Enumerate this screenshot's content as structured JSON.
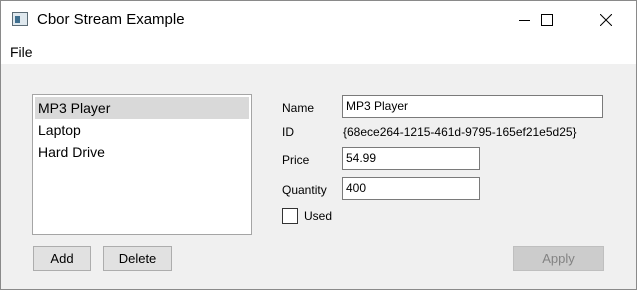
{
  "window": {
    "title": "Cbor Stream Example",
    "icon": "app-window-icon",
    "controls": [
      "minimize-icon",
      "maximize-icon",
      "close-icon"
    ]
  },
  "menu": {
    "file_label": "File"
  },
  "list": {
    "items": [
      {
        "label": "MP3 Player",
        "selected": true
      },
      {
        "label": "Laptop",
        "selected": false
      },
      {
        "label": "Hard Drive",
        "selected": false
      }
    ]
  },
  "buttons": {
    "add_label": "Add",
    "delete_label": "Delete",
    "apply_label": "Apply",
    "apply_enabled": false
  },
  "details": {
    "name_label": "Name",
    "name_value": "MP3 Player",
    "id_label": "ID",
    "id_value": "{68ece264-1215-461d-9795-165ef21e5d25}",
    "price_label": "Price",
    "price_value": "54.99",
    "quantity_label": "Quantity",
    "quantity_value": "400",
    "used_label": "Used",
    "used_checked": false
  }
}
